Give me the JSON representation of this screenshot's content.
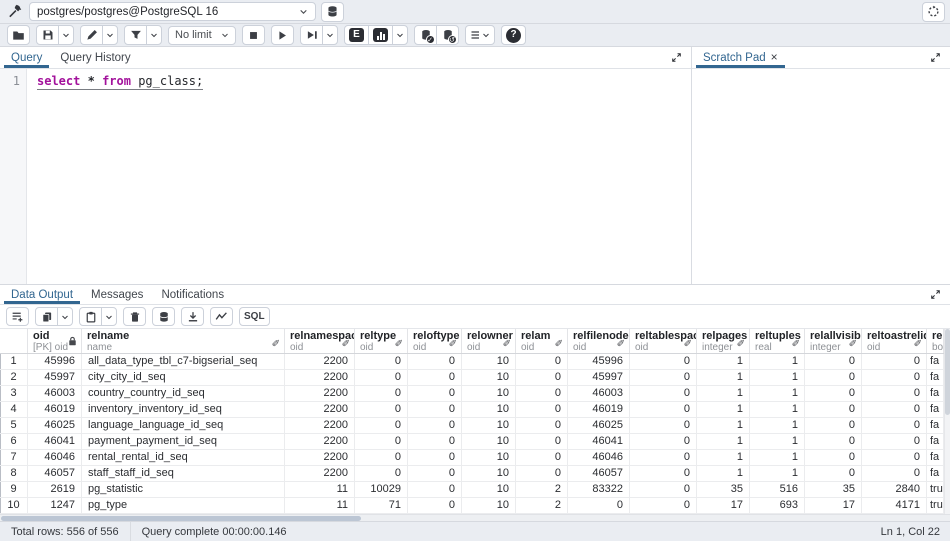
{
  "colors": {
    "accent_blue": "#326690",
    "sql_keyword": "#a2119b",
    "toolbar_bg": "#eaedf2"
  },
  "connection_bar": {
    "connection": "postgres/postgres@PostgreSQL 16"
  },
  "main_toolbar": {
    "limit_label": "No limit",
    "explain_label": "E"
  },
  "query_panel": {
    "tabs": [
      {
        "label": "Query"
      },
      {
        "label": "Query History"
      }
    ],
    "editor": {
      "line_number": "1",
      "kw1": "select",
      "star": "*",
      "kw2": "from",
      "rest": "pg_class;"
    }
  },
  "scratch_pad": {
    "label": "Scratch Pad"
  },
  "output_panel": {
    "tabs": [
      {
        "label": "Data Output"
      },
      {
        "label": "Messages"
      },
      {
        "label": "Notifications"
      }
    ],
    "toolbar": {
      "sql_label": "SQL"
    },
    "grid": {
      "columns": [
        {
          "name": "",
          "type": "",
          "icon": null,
          "align": "center"
        },
        {
          "name": "oid",
          "type": "[PK] oid",
          "icon": "lock",
          "align": "right"
        },
        {
          "name": "relname",
          "type": "name",
          "icon": "pencil",
          "align": "left"
        },
        {
          "name": "relnamespace",
          "type": "oid",
          "icon": "pencil",
          "align": "right"
        },
        {
          "name": "reltype",
          "type": "oid",
          "icon": "pencil",
          "align": "right"
        },
        {
          "name": "reloftype",
          "type": "oid",
          "icon": "pencil",
          "align": "right"
        },
        {
          "name": "relowner",
          "type": "oid",
          "icon": "pencil",
          "align": "right"
        },
        {
          "name": "relam",
          "type": "oid",
          "icon": "pencil",
          "align": "right"
        },
        {
          "name": "relfilenode",
          "type": "oid",
          "icon": "pencil",
          "align": "right"
        },
        {
          "name": "reltablespace",
          "type": "oid",
          "icon": "pencil",
          "align": "right"
        },
        {
          "name": "relpages",
          "type": "integer",
          "icon": "pencil",
          "align": "right"
        },
        {
          "name": "reltuples",
          "type": "real",
          "icon": "pencil",
          "align": "right"
        },
        {
          "name": "relallvisible",
          "type": "integer",
          "icon": "pencil",
          "align": "right"
        },
        {
          "name": "reltoastrelid",
          "type": "oid",
          "icon": "pencil",
          "align": "right"
        },
        {
          "name": "rel",
          "type": "bo",
          "icon": null,
          "align": "left"
        }
      ],
      "rows": [
        [
          "1",
          "45996",
          "all_data_type_tbl_c7-bigserial_seq",
          "2200",
          "0",
          "0",
          "10",
          "0",
          "45996",
          "0",
          "1",
          "1",
          "0",
          "0",
          "fa"
        ],
        [
          "2",
          "45997",
          "city_city_id_seq",
          "2200",
          "0",
          "0",
          "10",
          "0",
          "45997",
          "0",
          "1",
          "1",
          "0",
          "0",
          "fa"
        ],
        [
          "3",
          "46003",
          "country_country_id_seq",
          "2200",
          "0",
          "0",
          "10",
          "0",
          "46003",
          "0",
          "1",
          "1",
          "0",
          "0",
          "fa"
        ],
        [
          "4",
          "46019",
          "inventory_inventory_id_seq",
          "2200",
          "0",
          "0",
          "10",
          "0",
          "46019",
          "0",
          "1",
          "1",
          "0",
          "0",
          "fa"
        ],
        [
          "5",
          "46025",
          "language_language_id_seq",
          "2200",
          "0",
          "0",
          "10",
          "0",
          "46025",
          "0",
          "1",
          "1",
          "0",
          "0",
          "fa"
        ],
        [
          "6",
          "46041",
          "payment_payment_id_seq",
          "2200",
          "0",
          "0",
          "10",
          "0",
          "46041",
          "0",
          "1",
          "1",
          "0",
          "0",
          "fa"
        ],
        [
          "7",
          "46046",
          "rental_rental_id_seq",
          "2200",
          "0",
          "0",
          "10",
          "0",
          "46046",
          "0",
          "1",
          "1",
          "0",
          "0",
          "fa"
        ],
        [
          "8",
          "46057",
          "staff_staff_id_seq",
          "2200",
          "0",
          "0",
          "10",
          "0",
          "46057",
          "0",
          "1",
          "1",
          "0",
          "0",
          "fa"
        ],
        [
          "9",
          "2619",
          "pg_statistic",
          "11",
          "10029",
          "0",
          "10",
          "2",
          "83322",
          "0",
          "35",
          "516",
          "35",
          "2840",
          "tru"
        ],
        [
          "10",
          "1247",
          "pg_type",
          "11",
          "71",
          "0",
          "10",
          "2",
          "0",
          "0",
          "17",
          "693",
          "17",
          "4171",
          "tru"
        ]
      ]
    }
  },
  "status_bar": {
    "total_rows": "Total rows: 556 of 556",
    "query_status": "Query complete 00:00:00.146",
    "cursor_position": "Ln 1, Col 22"
  }
}
